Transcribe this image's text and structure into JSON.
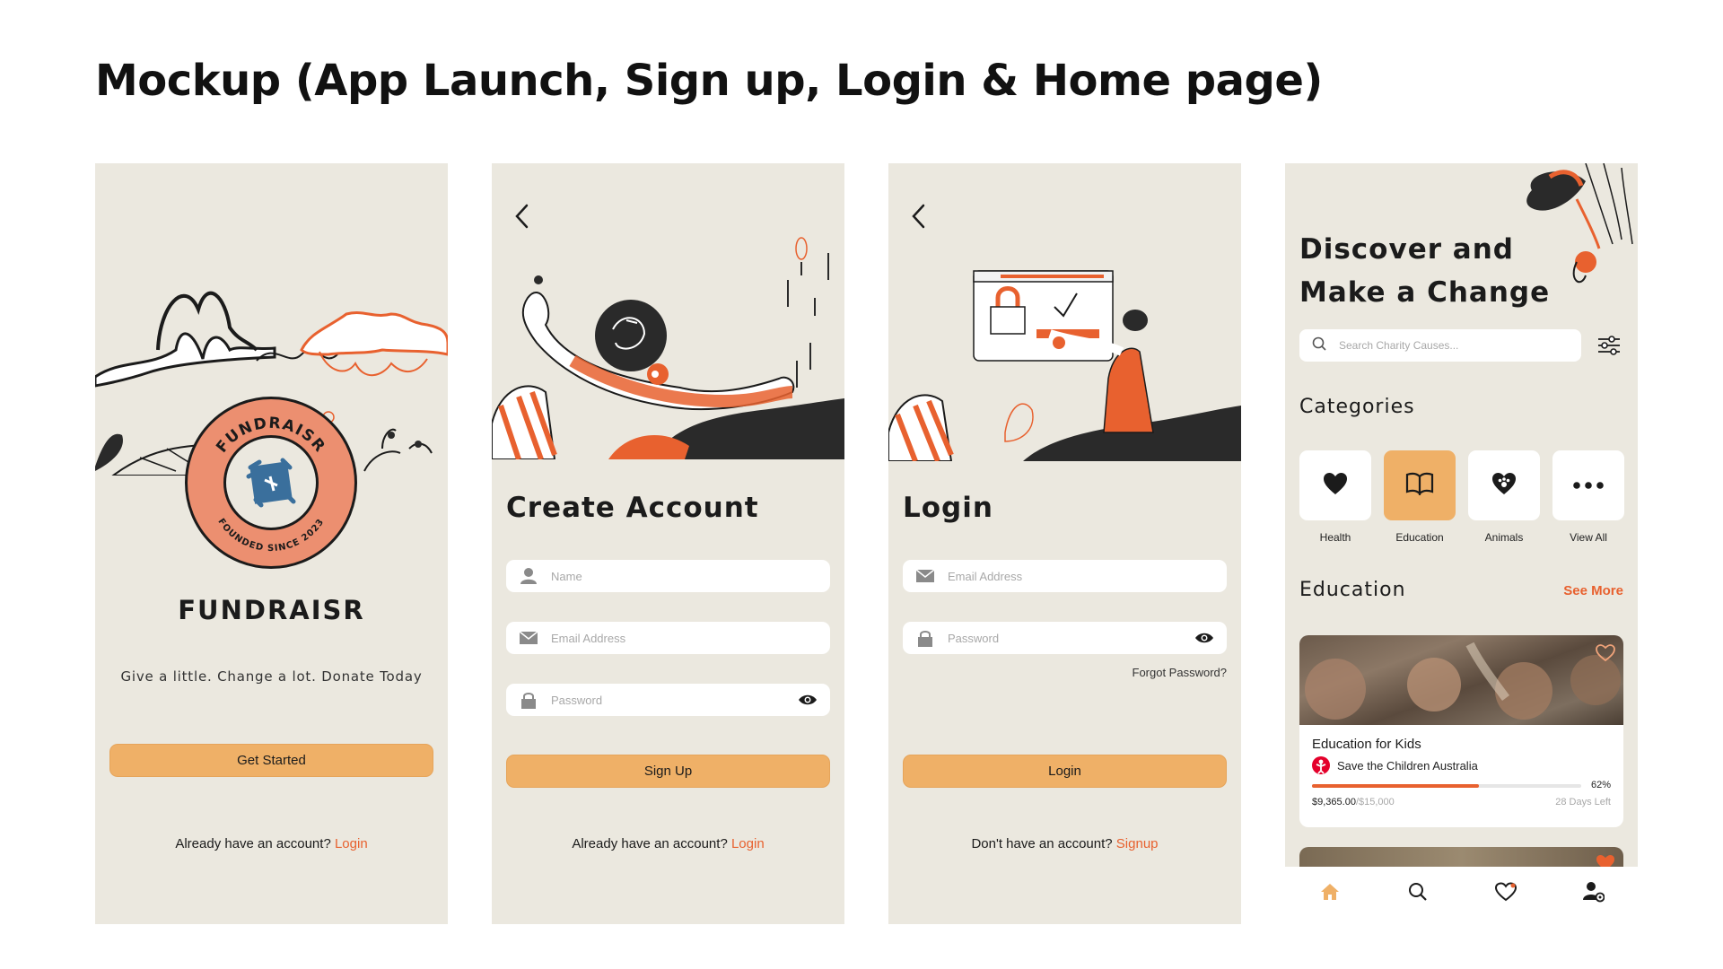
{
  "page_title": "Mockup (App Launch, Sign up, Login & Home page)",
  "colors": {
    "background": "#ebe8df",
    "accent": "#efb067",
    "link": "#e8612f",
    "brand_red": "#e8612f"
  },
  "launch": {
    "logo_ring_top": "FUNDRAISR",
    "logo_ring_bottom": "FOUNDED SINCE 2023",
    "app_name": "FUNDRAISR",
    "tagline": "Give a little. Change a lot. Donate Today",
    "cta": "Get Started",
    "footer_text": "Already have an account?",
    "footer_link": "Login"
  },
  "signup": {
    "heading": "Create Account",
    "name_placeholder": "Name",
    "email_placeholder": "Email Address",
    "password_placeholder": "Password",
    "submit": "Sign Up",
    "footer_text": "Already have an account?",
    "footer_link": "Login"
  },
  "login": {
    "heading": "Login",
    "email_placeholder": "Email Address",
    "password_placeholder": "Password",
    "forgot": "Forgot Password?",
    "submit": "Login",
    "footer_text": "Don't have an account?",
    "footer_link": "Signup"
  },
  "home": {
    "heading_line1": "Discover and",
    "heading_line2": "Make a Change",
    "search_placeholder": "Search Charity Causes...",
    "categories_title": "Categories",
    "categories": [
      {
        "label": "Health",
        "icon": "heart-icon",
        "active": false
      },
      {
        "label": "Education",
        "icon": "book-icon",
        "active": true
      },
      {
        "label": "Animals",
        "icon": "paw-heart-icon",
        "active": false
      },
      {
        "label": "View All",
        "icon": "more-icon",
        "active": false
      }
    ],
    "section_title": "Education",
    "see_more": "See More",
    "card": {
      "title": "Education for Kids",
      "org": "Save the Children Australia",
      "progress_percent": 62,
      "progress_label": "62%",
      "raised": "$9,365.00",
      "goal": "/$15,000",
      "days_left": "28 Days Left"
    },
    "nav": [
      "home-icon",
      "search-icon",
      "heart-icon",
      "profile-settings-icon"
    ]
  }
}
